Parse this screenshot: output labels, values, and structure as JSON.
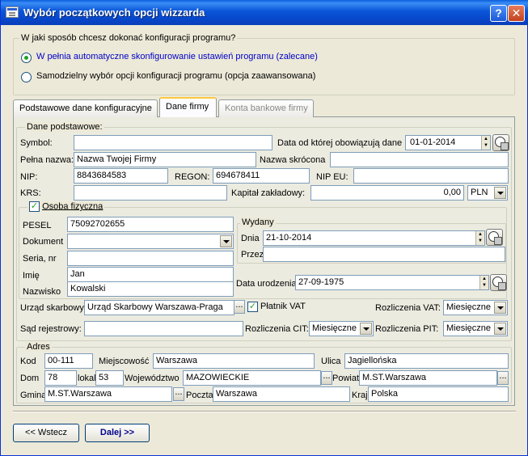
{
  "window": {
    "title": "Wybór początkowych opcji wizzarda",
    "help": "?",
    "close": "✕"
  },
  "config_group": {
    "label": "W jaki sposób chcesz dokonać konfiguracji programu?",
    "option_auto": "W pełnia automatyczne skonfigurowanie ustawień programu (zalecane)",
    "option_manual": "Samodzielny wybór opcji konfiguracji programu (opcja zaawansowana)",
    "selected": "auto"
  },
  "tabs": [
    {
      "label": "Podstawowe dane konfiguracyjne",
      "state": "normal"
    },
    {
      "label": "Dane firmy",
      "state": "active"
    },
    {
      "label": "Konta bankowe firmy",
      "state": "disabled"
    }
  ],
  "basic": {
    "group_label": "Dane podstawowe:",
    "symbol_label": "Symbol:",
    "symbol_value": "",
    "date_label": "Data od której obowiązują dane",
    "date_value": "01-01-2014",
    "fullname_label": "Pełna nazwa:",
    "fullname_value": "Nazwa Twojej Firmy",
    "shortname_label": "Nazwa skrócona",
    "shortname_value": "",
    "nip_label": "NIP:",
    "nip_value": "8843684583",
    "regon_label": "REGON:",
    "regon_value": "694678411",
    "nipeu_label": "NIP EU:",
    "nipeu_value": "",
    "krs_label": "KRS:",
    "krs_value": "",
    "capital_label": "Kapitał zakładowy:",
    "capital_value": "0,00",
    "currency": "PLN"
  },
  "person": {
    "checkbox_label": "Osoba fizyczna",
    "checked": true,
    "pesel_label": "PESEL",
    "pesel_value": "75092702655",
    "document_label": "Dokument",
    "document_value": "",
    "series_label": "Seria, nr",
    "series_value": "",
    "firstname_label": "Imię",
    "firstname_value": "Jan",
    "lastname_label": "Nazwisko",
    "lastname_value": "Kowalski",
    "issued_label": "Wydany",
    "day_label": "Dnia",
    "day_value": "21-10-2014",
    "by_label": "Przez",
    "by_value": "",
    "birth_label": "Data urodzenia",
    "birth_value": "27-09-1975"
  },
  "tax": {
    "office_label": "Urząd skarbowy:",
    "office_value": "Urząd Skarbowy Warszawa-Praga",
    "vat_payer_label": "Płatnik VAT",
    "vat_payer_checked": true,
    "vat_label": "Rozliczenia VAT:",
    "vat_value": "Miesięczne",
    "court_label": "Sąd rejestrowy:",
    "court_value": "",
    "cit_label": "Rozliczenia CIT:",
    "cit_value": "Miesięczne",
    "pit_label": "Rozliczenia PIT:",
    "pit_value": "Miesięczne"
  },
  "address": {
    "group_label": "Adres",
    "code_label": "Kod",
    "code_value": "00-111",
    "city_label": "Miejscowość",
    "city_value": "Warszawa",
    "street_label": "Ulica",
    "street_value": "Jagiellońska",
    "house_label": "Dom",
    "house_value": "78",
    "flat_label": "lokal",
    "flat_value": "53",
    "voiv_label": "Województwo",
    "voiv_value": "MAZOWIECKIE",
    "county_label": "Powiat",
    "county_value": "M.ST.Warszawa",
    "commune_label": "Gmina",
    "commune_value": "M.ST.Warszawa",
    "post_label": "Poczta",
    "post_value": "Warszawa",
    "country_label": "Kraj",
    "country_value": "Polska"
  },
  "buttons": {
    "back": "<< Wstecz",
    "next": "Dalej >>",
    "ellipsis": "..."
  }
}
